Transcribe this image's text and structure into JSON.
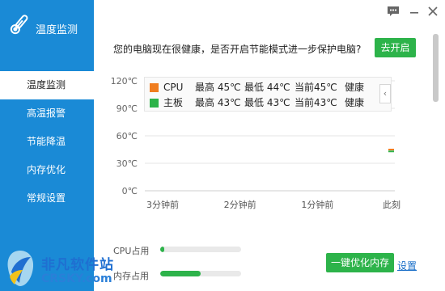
{
  "app": {
    "title": "温度监测"
  },
  "titlebar": {
    "feedback_icon": "chat-bubble-icon",
    "minimize_icon": "minimize-icon",
    "close_icon": "close-icon"
  },
  "sidebar": {
    "items": [
      {
        "label": "温度监测",
        "active": true
      },
      {
        "label": "高温报警",
        "active": false
      },
      {
        "label": "节能降温",
        "active": false
      },
      {
        "label": "内存优化",
        "active": false
      },
      {
        "label": "常规设置",
        "active": false
      }
    ]
  },
  "prompt": {
    "text": "您的电脑现在很健康，是否开启节能模式进一步保护电脑?",
    "button": "去开启"
  },
  "chart_data": {
    "type": "line",
    "title": "",
    "xlabel": "",
    "ylabel": "",
    "y_ticks": [
      "120℃",
      "90℃",
      "60℃",
      "30℃",
      "0℃"
    ],
    "ylim": [
      0,
      120
    ],
    "x_ticks": [
      "3分钟前",
      "2分钟前",
      "1分钟前",
      "此刻"
    ],
    "grid": true,
    "legend_position": "top",
    "series": [
      {
        "name": "CPU",
        "color": "#f07d1e",
        "max": "最高 45℃",
        "min": "最低 44℃",
        "current": "当前45℃",
        "status": "健康",
        "values": [
          45
        ]
      },
      {
        "name": "主板",
        "color": "#2db34a",
        "max": "最高 43℃",
        "min": "最低 43℃",
        "current": "当前43℃",
        "status": "健康",
        "values": [
          43
        ]
      }
    ]
  },
  "usage": {
    "cpu": {
      "label": "CPU占用",
      "percent": 5
    },
    "mem": {
      "label": "内存占用",
      "percent": 50
    }
  },
  "actions": {
    "optimize": "一键优化内存",
    "settings": "设置"
  },
  "watermark": {
    "cn": "非凡软件站",
    "en": "CRSKY.com"
  },
  "colors": {
    "sidebar": "#1a8ad6",
    "accent_green": "#2db34a",
    "cpu": "#f07d1e",
    "board": "#2db34a"
  }
}
